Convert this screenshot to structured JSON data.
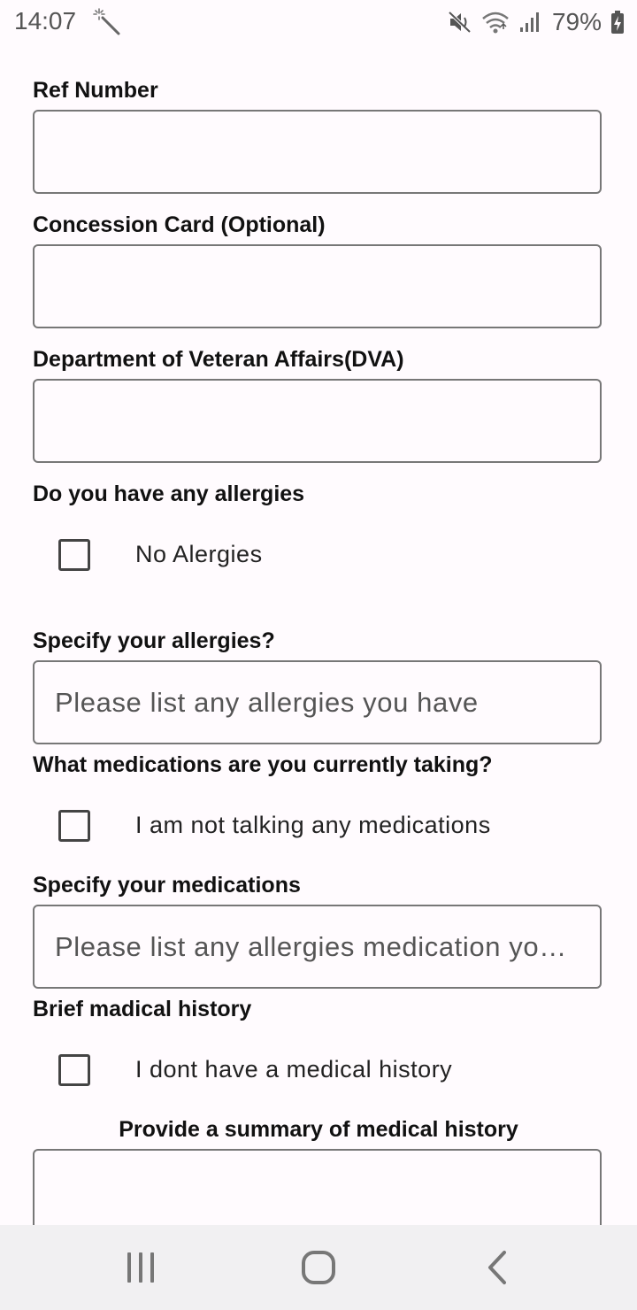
{
  "status_bar": {
    "time": "14:07",
    "battery": "79%",
    "icons": [
      "magic-wand-icon",
      "mute-icon",
      "wifi-icon",
      "signal-icon",
      "battery-charging-icon"
    ]
  },
  "form": {
    "ref_number": {
      "label": "Ref Number",
      "value": ""
    },
    "concession_card": {
      "label": "Concession Card (Optional)",
      "value": ""
    },
    "dva": {
      "label": "Department of Veteran Affairs(DVA)",
      "value": ""
    },
    "allergies_question": {
      "label": "Do you have any allergies"
    },
    "no_allergies": {
      "label": "No Alergies",
      "checked": false
    },
    "specify_allergies": {
      "label": "Specify your allergies?",
      "placeholder": "Please list any allergies you have"
    },
    "medications_question": {
      "label": "What medications are you currently taking?"
    },
    "no_medications": {
      "label": "I am not talking any medications",
      "checked": false
    },
    "specify_medications": {
      "label": "Specify your medications",
      "placeholder": "Please list any allergies medication you are taking"
    },
    "medical_history": {
      "label": "Brief madical history"
    },
    "no_medical_history": {
      "label": "I dont have a medical history",
      "checked": false
    },
    "history_summary": {
      "label": "Provide a summary of medical history",
      "value": ""
    }
  },
  "nav_bar": {
    "buttons": [
      "recent-apps-icon",
      "home-icon",
      "back-icon"
    ]
  }
}
